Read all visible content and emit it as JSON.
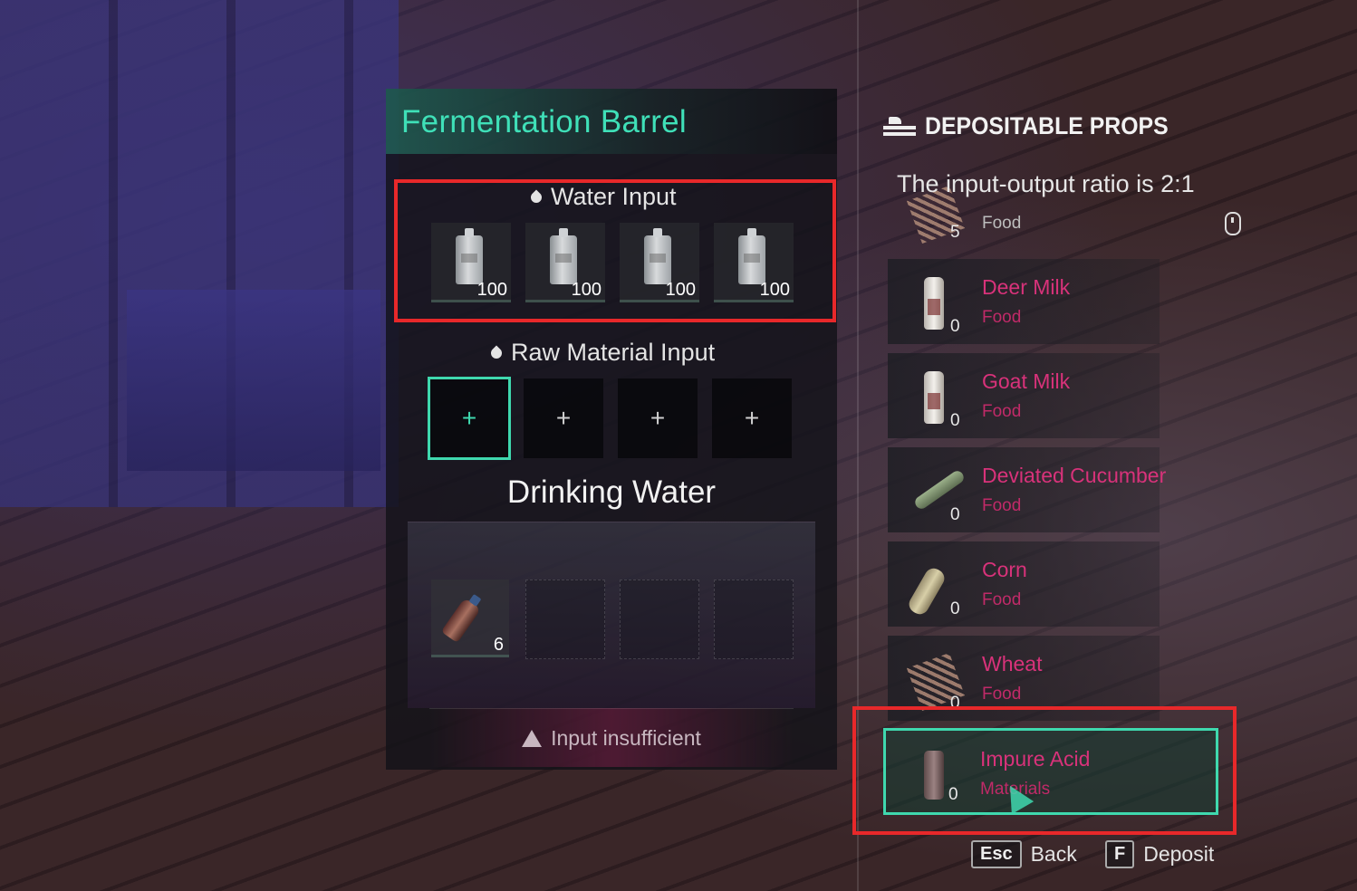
{
  "barrel": {
    "title": "Fermentation Barrel",
    "water_input": {
      "label": "Water Input",
      "slots": [
        {
          "icon": "water-pouch-icon",
          "qty": "100"
        },
        {
          "icon": "water-pouch-icon",
          "qty": "100"
        },
        {
          "icon": "water-pouch-icon",
          "qty": "100"
        },
        {
          "icon": "water-pouch-icon",
          "qty": "100"
        }
      ]
    },
    "raw_material": {
      "label": "Raw Material Input",
      "slots": [
        "+",
        "+",
        "+",
        "+"
      ]
    },
    "output": {
      "title": "Drinking Water",
      "slots": [
        {
          "icon": "bottle-icon",
          "qty": "6"
        },
        null,
        null,
        null
      ]
    },
    "warning": "Input insufficient"
  },
  "props": {
    "title": "DEPOSITABLE PROPS",
    "ratio": "The input-output ratio is 2:1",
    "items": [
      {
        "name": "",
        "category": "Food",
        "count": "5",
        "icon": "wheat-icon"
      },
      {
        "name": "Deer Milk",
        "category": "Food",
        "count": "0",
        "icon": "milk-bottle-icon"
      },
      {
        "name": "Goat Milk",
        "category": "Food",
        "count": "0",
        "icon": "milk-bottle-icon"
      },
      {
        "name": "Deviated Cucumber",
        "category": "Food",
        "count": "0",
        "icon": "cucumber-icon"
      },
      {
        "name": "Corn",
        "category": "Food",
        "count": "0",
        "icon": "corn-icon"
      },
      {
        "name": "Wheat",
        "category": "Food",
        "count": "0",
        "icon": "wheat-icon"
      },
      {
        "name": "Impure Acid",
        "category": "Materials",
        "count": "0",
        "icon": "acid-bottle-icon"
      }
    ]
  },
  "footer": {
    "back_key": "Esc",
    "back_label": "Back",
    "deposit_key": "F",
    "deposit_label": "Deposit"
  },
  "colors": {
    "accent": "#3fd8ae",
    "highlight_box": "#e8282a",
    "item_name": "#d8327a"
  }
}
